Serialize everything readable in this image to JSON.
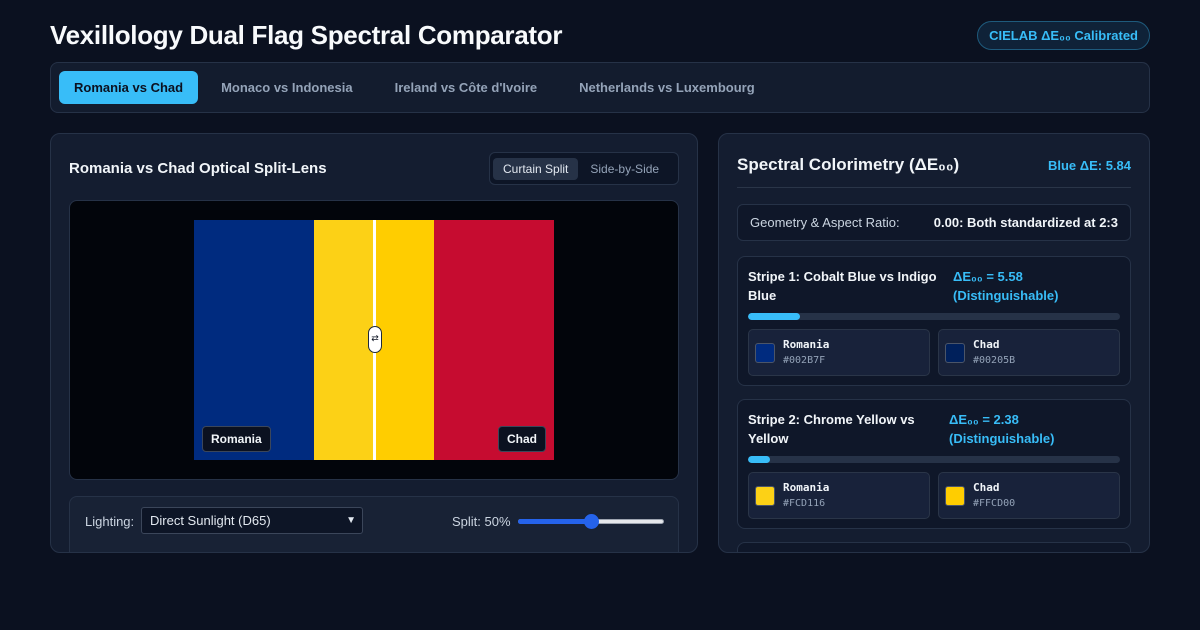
{
  "header": {
    "title": "Vexillology Dual Flag Spectral Comparator",
    "badge": "CIELAB ΔE₀₀ Calibrated"
  },
  "tabs": [
    {
      "label": "Romania vs Chad",
      "active": true
    },
    {
      "label": "Monaco vs Indonesia",
      "active": false
    },
    {
      "label": "Ireland vs Côte d'Ivoire",
      "active": false
    },
    {
      "label": "Netherlands vs Luxembourg",
      "active": false
    }
  ],
  "lens": {
    "title": "Romania vs Chad Optical Split-Lens",
    "modes": [
      "Curtain Split",
      "Side-by-Side"
    ],
    "active_mode": "Curtain Split",
    "left_flag": "Romania",
    "right_flag": "Chad",
    "handle_glyph": "⇄",
    "split_percent": 50,
    "lighting_label": "Lighting:",
    "lighting_value": "Direct Sunlight (D65)",
    "split_label": "Split: 50%",
    "colors": {
      "romania": [
        "#002B7F",
        "#FCD116",
        "#CE1126"
      ],
      "chad": [
        "#00205B",
        "#FFCD00",
        "#C60C30"
      ]
    }
  },
  "spectral": {
    "title": "Spectral Colorimetry (ΔE₀₀)",
    "headline": "Blue ΔE: 5.84",
    "geometry": {
      "label": "Geometry & Aspect Ratio:",
      "value": "0.00: Both standardized at 2:3"
    },
    "stripes": [
      {
        "name": "Stripe 1: Cobalt Blue vs Indigo Blue",
        "delta_text": "ΔE₀₀ = 5.58 (Distinguishable)",
        "delta": 5.58,
        "bar_fraction": 0.14,
        "a": {
          "country": "Romania",
          "hex": "#002B7F"
        },
        "b": {
          "country": "Chad",
          "hex": "#00205B"
        }
      },
      {
        "name": "Stripe 2: Chrome Yellow vs Yellow",
        "delta_text": "ΔE₀₀ = 2.38 (Distinguishable)",
        "delta": 2.38,
        "bar_fraction": 0.06,
        "a": {
          "country": "Romania",
          "hex": "#FCD116"
        },
        "b": {
          "country": "Chad",
          "hex": "#FFCD00"
        }
      }
    ]
  }
}
